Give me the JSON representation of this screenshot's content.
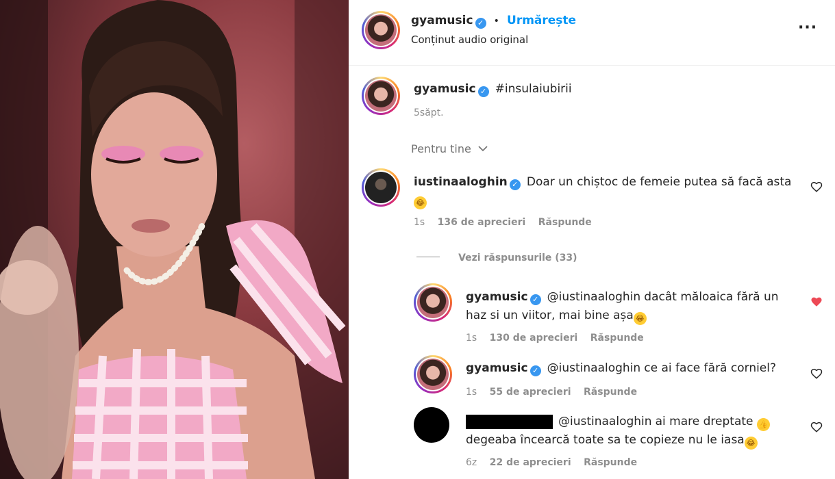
{
  "header": {
    "username": "gyamusic",
    "separator": "•",
    "follow_label": "Urmărește",
    "subtitle": "Conținut audio original",
    "more_icon": "more-horizontal-icon",
    "more_glyph": "···"
  },
  "caption": {
    "username": "gyamusic",
    "text": "#insulaiubirii",
    "time": "5săpt."
  },
  "sort": {
    "label": "Pentru tine",
    "icon": "chevron-down-icon"
  },
  "comments": [
    {
      "username": "iustinaaloghin",
      "text": "Doar un chiștoc de femeie putea să facă asta",
      "emoji": "rolling-on-floor-laughing",
      "time": "1s",
      "likes": "136 de aprecieri",
      "reply": "Răspunde",
      "view_replies": "Vezi răspunsurile (33)"
    }
  ],
  "replies": [
    {
      "username": "gyamusic",
      "mention": "@iustinaaloghin",
      "text_line1": "dacât măloaica fără un",
      "text_line2": "haz si un viitor, mai bine așa",
      "emoji": "tears-of-joy",
      "time": "1s",
      "likes": "130 de aprecieri",
      "reply": "Răspunde",
      "liked": true,
      "liked_color": "#ed4956"
    },
    {
      "username": "gyamusic",
      "mention": "@iustinaaloghin",
      "text": "ce ai face fără corniel?",
      "time": "1s",
      "likes": "55 de aprecieri",
      "reply": "Răspunde",
      "liked": false
    },
    {
      "mention": "@iustinaaloghin",
      "text_line1": "ai mare dreptate",
      "emoji1": "thumbs-up",
      "text_line2": "degeaba încearcă toate sa te copieze nu le iasa",
      "emoji2": "tears-of-joy",
      "time": "6z",
      "likes": "22 de aprecieri",
      "reply": "Răspunde",
      "liked": false
    }
  ],
  "colors": {
    "verified": "#3897f0",
    "link": "#00376b",
    "follow": "#0095f6",
    "muted": "#8e8e8e"
  }
}
